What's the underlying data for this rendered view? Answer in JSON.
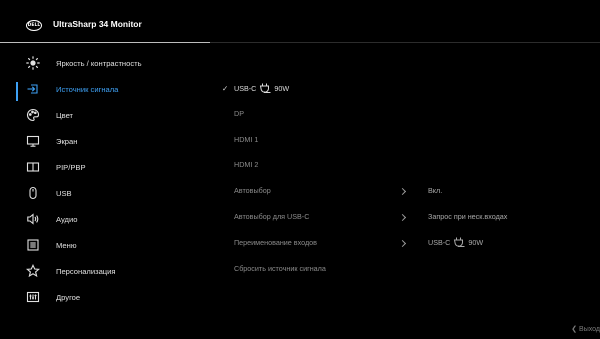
{
  "header": {
    "logo_text": "DELL",
    "title": "UltraSharp 34 Monitor"
  },
  "menu": {
    "items": [
      {
        "label": "Яркость / контрастность",
        "icon": "brightness-icon"
      },
      {
        "label": "Источник сигнала",
        "icon": "input-source-icon",
        "active": true
      },
      {
        "label": "Цвет",
        "icon": "color-palette-icon"
      },
      {
        "label": "Экран",
        "icon": "display-icon"
      },
      {
        "label": "PIP/PBP",
        "icon": "pip-pbp-icon"
      },
      {
        "label": "USB",
        "icon": "usb-mouse-icon"
      },
      {
        "label": "Аудио",
        "icon": "speaker-icon"
      },
      {
        "label": "Меню",
        "icon": "menu-list-icon"
      },
      {
        "label": "Персонализация",
        "icon": "star-icon"
      },
      {
        "label": "Другое",
        "icon": "other-icon"
      }
    ]
  },
  "submenu": {
    "usbc_label": "USB-C",
    "usbc_power": "90W",
    "dp": "DP",
    "hdmi1": "HDMI 1",
    "hdmi2": "HDMI 2",
    "auto_select": "Автовыбор",
    "auto_select_usbc": "Автовыбор для USB-C",
    "rename_inputs": "Переименование входов",
    "reset_source": "Сбросить источник сигнала"
  },
  "values": {
    "auto_select_value": "Вкл.",
    "auto_select_usbc_value": "Запрос при неск.входах",
    "rename_label": "USB-C",
    "rename_power": "90W"
  },
  "footer": {
    "exit": "❮ Выход"
  },
  "colors": {
    "accent": "#3ea1f5",
    "background": "#000000"
  }
}
